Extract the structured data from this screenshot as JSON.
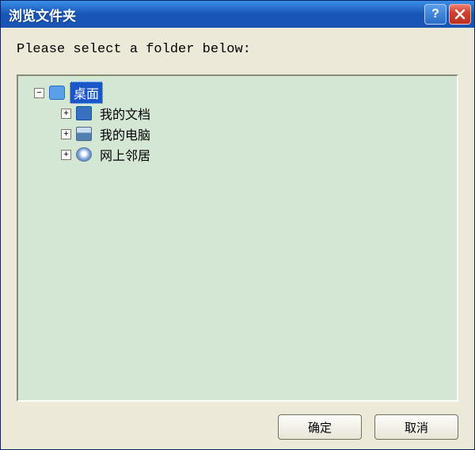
{
  "titlebar": {
    "title": "浏览文件夹"
  },
  "prompt": "Please select a folder below:",
  "tree": {
    "root": {
      "label": "桌面",
      "expanded": true,
      "selected": true,
      "icon": "desktop",
      "children": [
        {
          "label": "我的文档",
          "expanded": false,
          "selected": false,
          "icon": "mydocs"
        },
        {
          "label": "我的电脑",
          "expanded": false,
          "selected": false,
          "icon": "mycomp"
        },
        {
          "label": "网上邻居",
          "expanded": false,
          "selected": false,
          "icon": "network"
        }
      ]
    }
  },
  "buttons": {
    "ok": "确定",
    "cancel": "取消"
  }
}
